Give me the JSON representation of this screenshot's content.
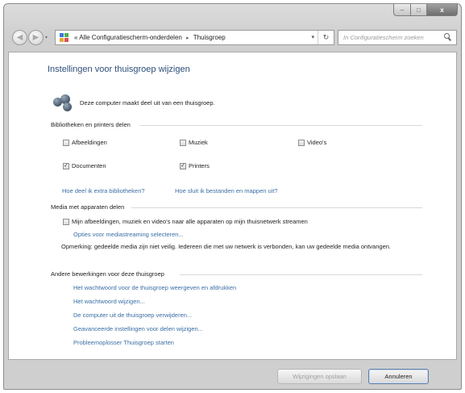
{
  "window": {
    "caption": {
      "minimize": "–",
      "maximize": "□",
      "close": "x"
    }
  },
  "nav": {
    "back_glyph": "◀",
    "forward_glyph": "▶",
    "recent_glyph": "▾"
  },
  "address": {
    "chevron": "«",
    "crumbs": [
      "Alle Configuratiescherm-onderdelen",
      "Thuisgroep"
    ],
    "separator": "▸",
    "dropdown_glyph": "▾",
    "refresh_glyph": "↻"
  },
  "search": {
    "placeholder": "In Configuratiescherm zoeken"
  },
  "page": {
    "title": "Instellingen voor thuisgroep wijzigen",
    "status": "Deze computer maakt deel uit van een thuisgroep."
  },
  "libraries": {
    "heading": "Bibliotheken en printers delen",
    "items": [
      {
        "label": "Afbeeldingen",
        "checked": false
      },
      {
        "label": "Muziek",
        "checked": false
      },
      {
        "label": "Video's",
        "checked": false
      },
      {
        "label": "Documenten",
        "checked": true
      },
      {
        "label": "Printers",
        "checked": true
      }
    ],
    "links": [
      "Hoe deel ik extra bibliotheken?",
      "Hoe sluit ik bestanden en mappen uit?"
    ]
  },
  "media": {
    "heading": "Media met apparaten delen",
    "stream_label": "Mijn afbeeldingen, muziek en video's naar alle apparaten op mijn thuisnetwerk streamen",
    "stream_checked": false,
    "options_link": "Opties voor mediastreaming selecteren...",
    "note": "Opmerking: gedeelde media zijn niet veilig. Iedereen die met uw netwerk is verbonden, kan uw gedeelde media ontvangen."
  },
  "other": {
    "heading": "Andere bewerkingen voor deze thuisgroep",
    "links": [
      "Het wachtwoord voor de thuisgroep weergeven en afdrukken",
      "Het wachtwoord wijzigen...",
      "De computer uit de thuisgroep verwijderen...",
      "Geavanceerde instellingen voor delen wijzigen...",
      "Probleemoplosser Thuisgroep starten"
    ]
  },
  "footer": {
    "save_label": "Wijzigingen opslaan",
    "save_enabled": false,
    "cancel_label": "Annuleren"
  },
  "colors": {
    "title": "#2e4e7a",
    "link": "#3a6ea5",
    "disabled_text": "#a0a0a0"
  }
}
